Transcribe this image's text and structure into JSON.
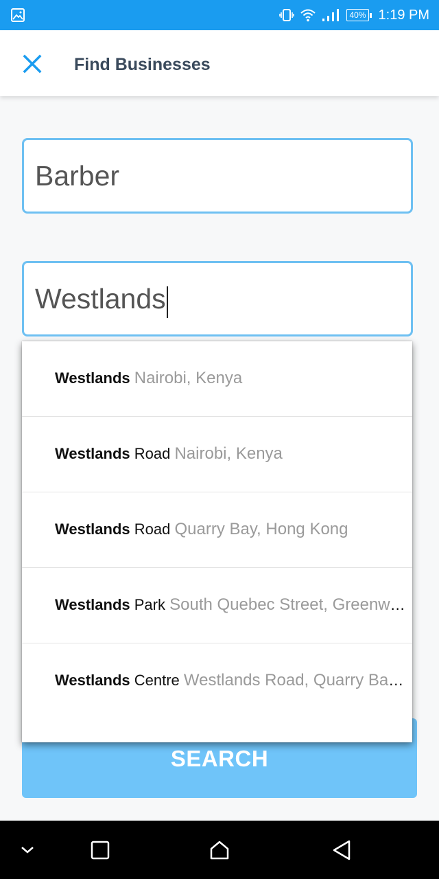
{
  "status_bar": {
    "time": "1:19 PM",
    "battery": "40%",
    "icons": [
      "image-icon",
      "vibrate-icon",
      "wifi-icon",
      "signal-icon",
      "battery-icon"
    ]
  },
  "app_bar": {
    "title": "Find Businesses",
    "close_icon": "close-icon"
  },
  "form": {
    "what_value": "Barber",
    "where_value": "Westlands"
  },
  "suggestions": [
    {
      "bold": "Westlands",
      "rest": "",
      "secondary": "Nairobi, Kenya"
    },
    {
      "bold": "Westlands",
      "rest": " Road",
      "secondary": "Nairobi, Kenya"
    },
    {
      "bold": "Westlands",
      "rest": " Road",
      "secondary": "Quarry Bay, Hong Kong"
    },
    {
      "bold": "Westlands",
      "rest": " Park",
      "secondary": "South Quebec Street, Greenwood Village"
    },
    {
      "bold": "Westlands",
      "rest": " Centre",
      "secondary": "Westlands Road, Quarry Bay, Hong Kong"
    }
  ],
  "search_button": {
    "label": "SEARCH"
  },
  "nav_bar": {
    "icons": [
      "chevron-down-icon",
      "recents-icon",
      "home-icon",
      "back-icon"
    ]
  },
  "colors": {
    "accent": "#1a9cf0",
    "field_border": "#6ec0f2",
    "button": "#6fc4f9",
    "title": "#3a4a5c"
  }
}
